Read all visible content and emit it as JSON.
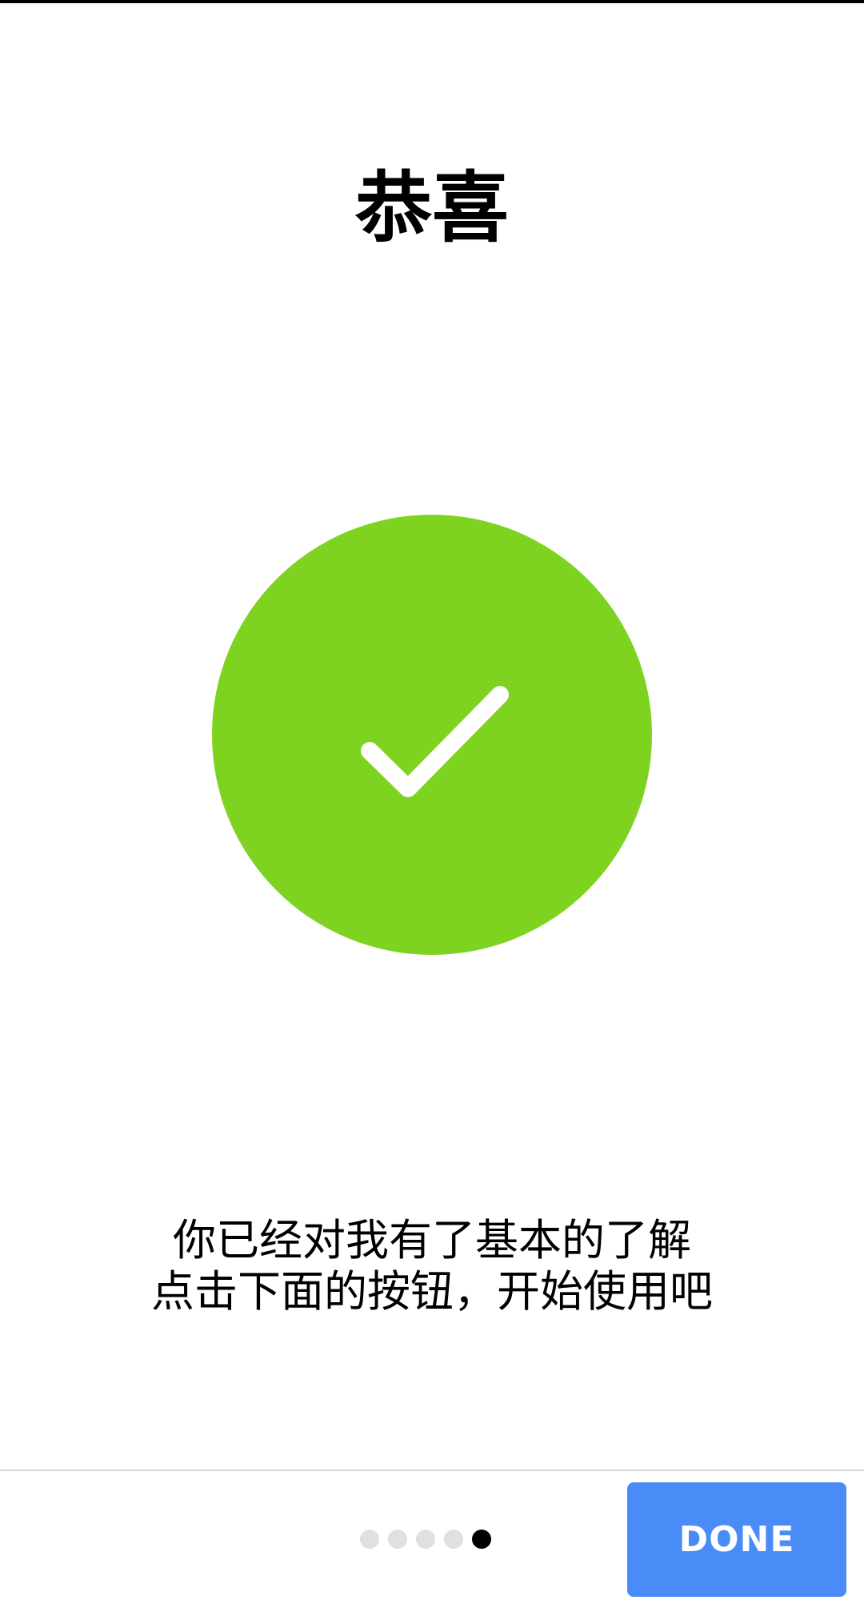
{
  "page": {
    "title": "恭喜",
    "message_line_1": "你已经对我有了基本的了解",
    "message_line_2": "点击下面的按钮，开始使用吧"
  },
  "hero": {
    "icon": "checkmark-icon",
    "circle_color": "#7ED321",
    "check_color": "#ffffff"
  },
  "pager": {
    "total": 5,
    "current": 5
  },
  "footer": {
    "done_label": "DONE",
    "done_color": "#4A8CF7"
  }
}
